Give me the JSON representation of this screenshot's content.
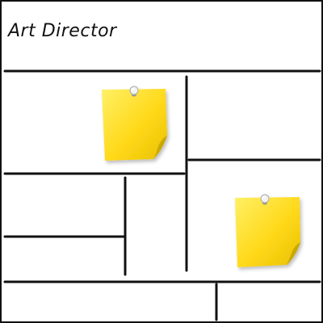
{
  "title": "Art Director",
  "colors": {
    "line": "#111111",
    "note_base": "#ffd91a",
    "note_light": "#fff066",
    "note_shadow": "#c9a800",
    "pin_head": "#f2f2f2"
  },
  "sticky_notes": [
    {
      "id": "note-1",
      "text": ""
    },
    {
      "id": "note-2",
      "text": ""
    }
  ]
}
